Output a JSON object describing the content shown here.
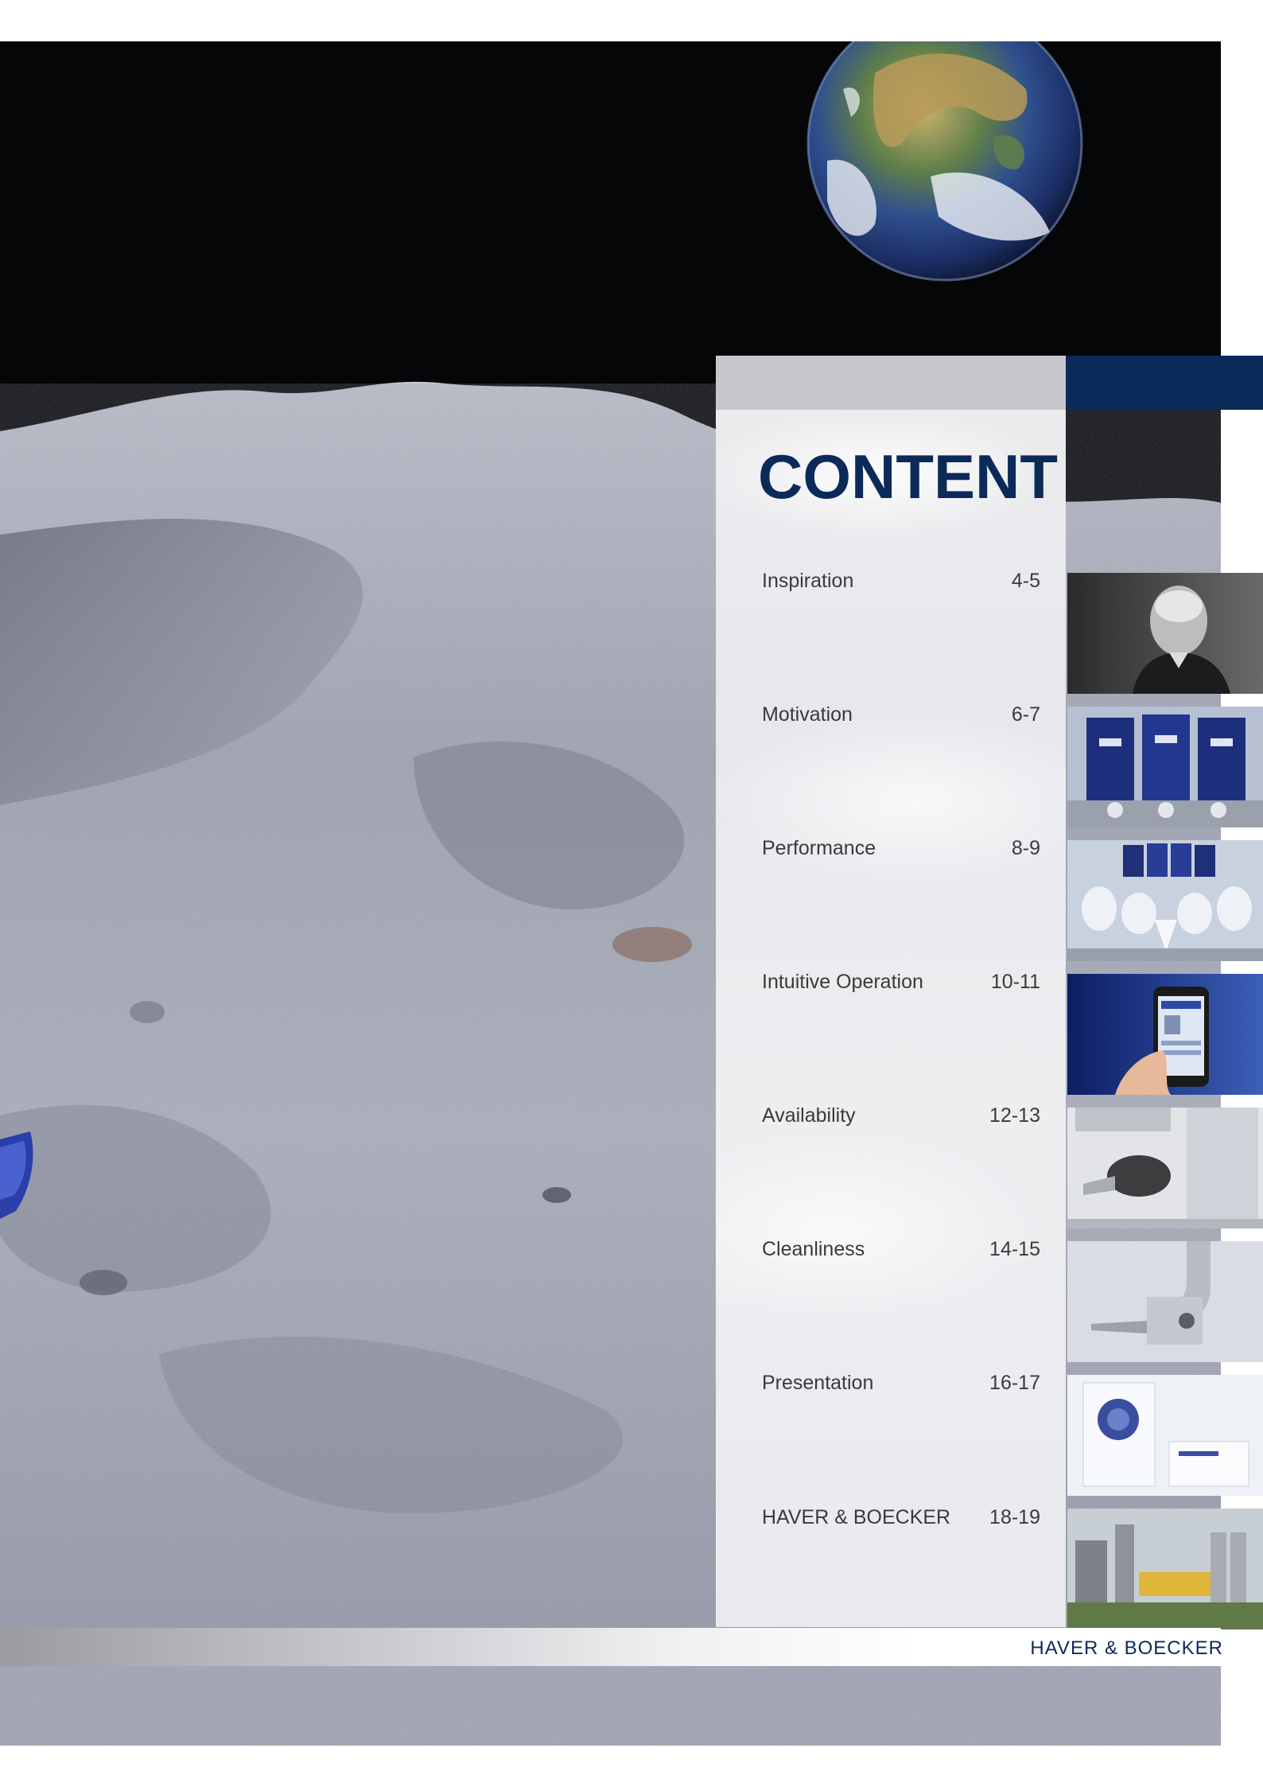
{
  "panel": {
    "title": "CONTENT"
  },
  "toc": [
    {
      "label": "Inspiration",
      "pages": "4-5"
    },
    {
      "label": "Motivation",
      "pages": "6-7"
    },
    {
      "label": "Performance",
      "pages": "8-9"
    },
    {
      "label": "Intuitive Operation",
      "pages": "10-11"
    },
    {
      "label": "Availability",
      "pages": "12-13"
    },
    {
      "label": "Cleanliness",
      "pages": "14-15"
    },
    {
      "label": "Presentation",
      "pages": "16-17"
    },
    {
      "label": "HAVER & BOECKER",
      "pages": "18-19"
    }
  ],
  "footer": {
    "brand": "HAVER & BOECKER"
  },
  "colors": {
    "brand_blue": "#0b2a5a",
    "text_gray": "#3a3a3c"
  }
}
